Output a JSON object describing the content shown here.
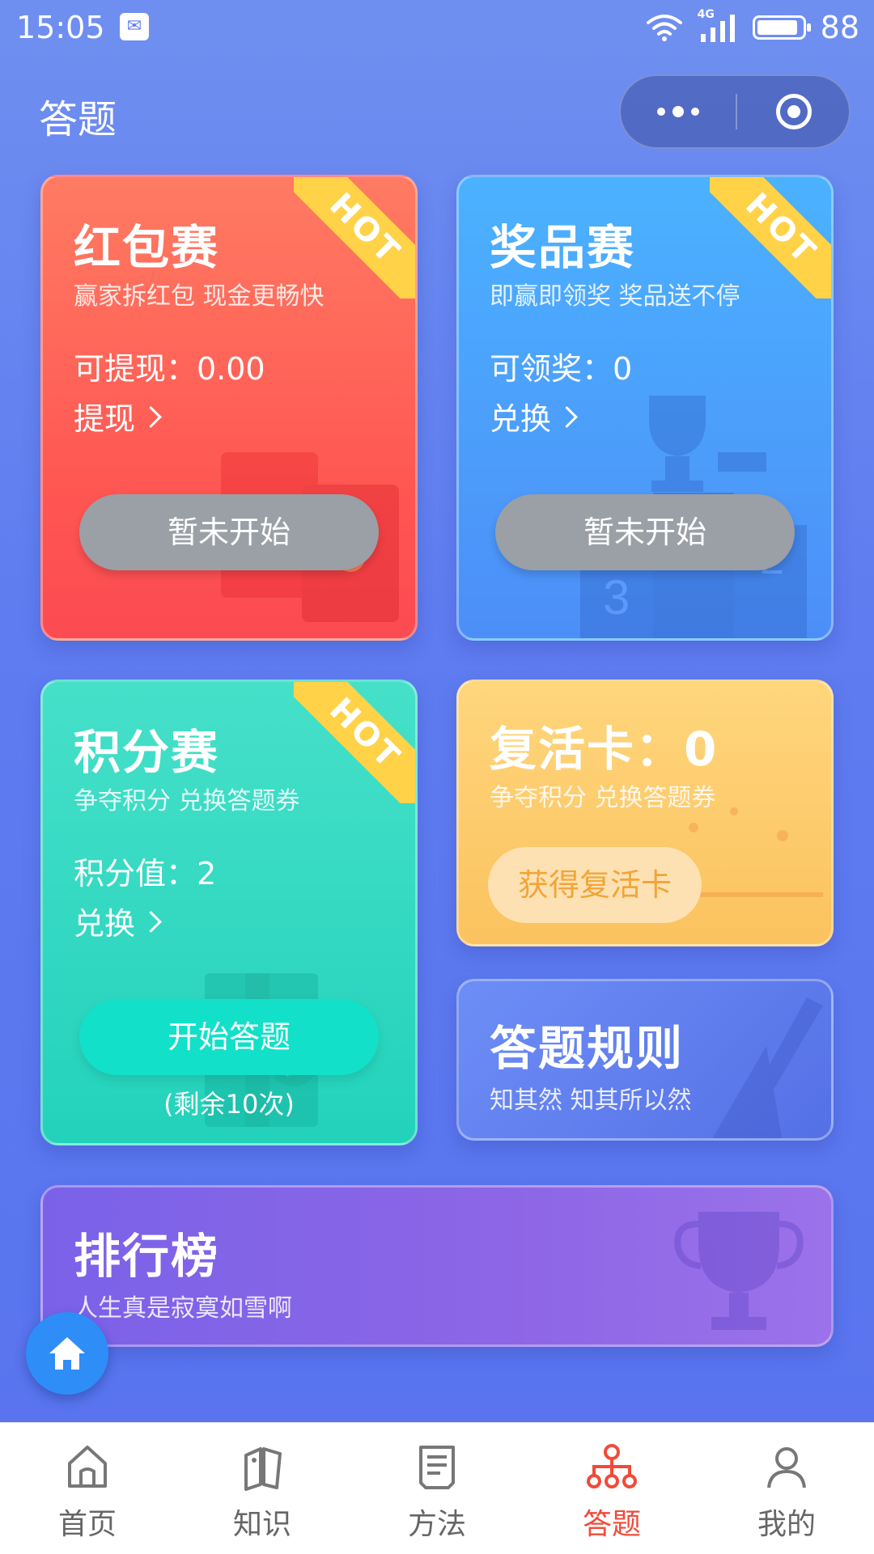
{
  "status": {
    "time": "15:05",
    "network": "4G",
    "battery": "88"
  },
  "header": {
    "title": "答题"
  },
  "cards": {
    "red": {
      "title": "红包赛",
      "subtitle": "赢家拆红包 现金更畅快",
      "stat": "可提现：0.00",
      "link": "提现",
      "button": "暂未开始",
      "badge": "HOT"
    },
    "blue": {
      "title": "奖品赛",
      "subtitle": "即赢即领奖 奖品送不停",
      "stat": "可领奖：0",
      "link": "兑换",
      "button": "暂未开始",
      "badge": "HOT",
      "podium_number": "3",
      "podium_number2": "2"
    },
    "green": {
      "title": "积分赛",
      "subtitle": "争夺积分 兑换答题券",
      "stat": "积分值：2",
      "link": "兑换",
      "button": "开始答题",
      "remaining": "(剩余10次)",
      "badge": "HOT",
      "gift_text": "礼"
    },
    "yellow": {
      "title": "复活卡：0",
      "subtitle": "争夺积分 兑换答题券",
      "button": "获得复活卡"
    },
    "rules": {
      "title": "答题规则",
      "subtitle": "知其然 知其所以然"
    },
    "ranking": {
      "title": "排行榜",
      "subtitle": "人生真是寂寞如雪啊"
    }
  },
  "tabbar": {
    "items": [
      {
        "label": "首页",
        "icon": "home-icon"
      },
      {
        "label": "知识",
        "icon": "knowledge-icon"
      },
      {
        "label": "方法",
        "icon": "method-icon"
      },
      {
        "label": "答题",
        "icon": "quiz-icon",
        "active": true
      },
      {
        "label": "我的",
        "icon": "profile-icon"
      }
    ]
  },
  "colors": {
    "active_tab": "#f24a3a",
    "inactive_tab": "#666666",
    "hot_badge": "#ffd248",
    "fab": "#2f8df7"
  }
}
